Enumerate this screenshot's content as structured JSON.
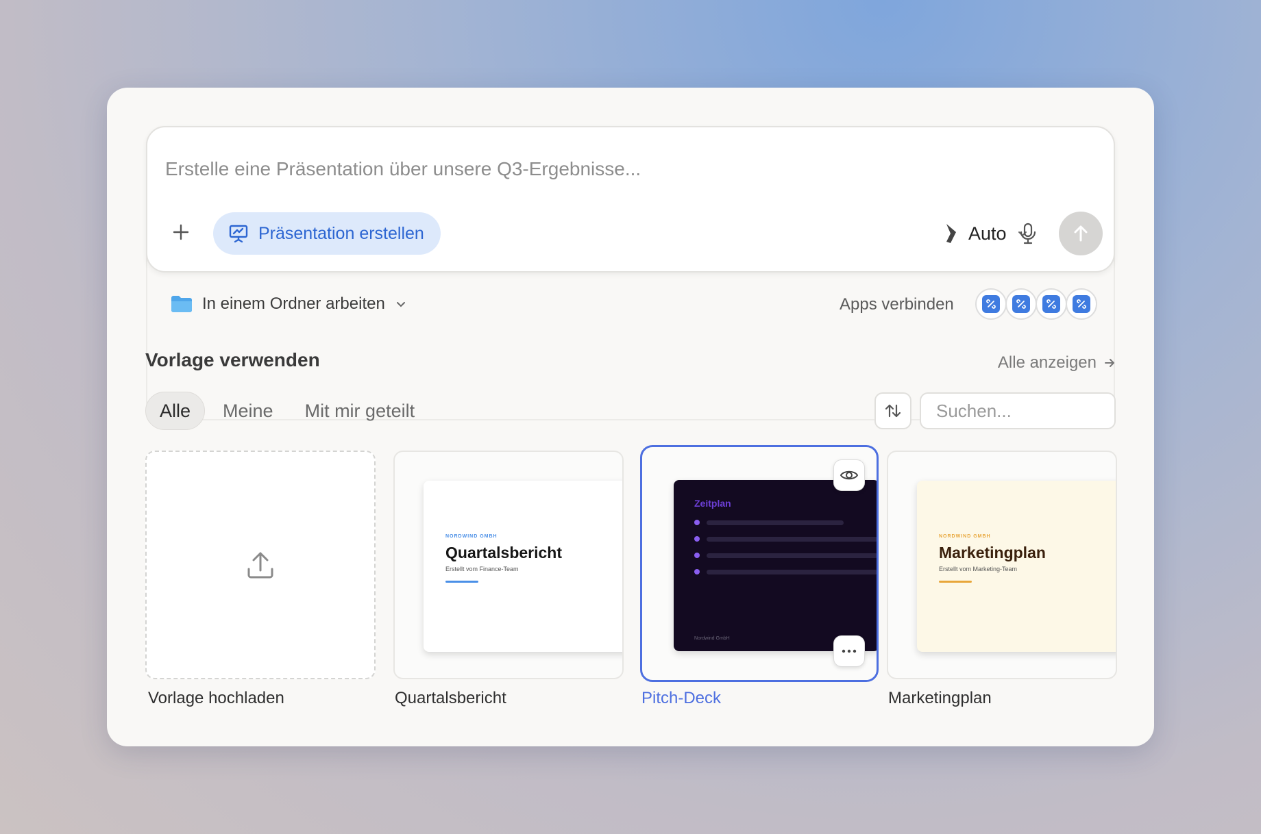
{
  "composer": {
    "placeholder": "Erstelle eine Präsentation über unsere Q3-Ergebnisse...",
    "mode_label": "Präsentation erstellen",
    "model_label": "Auto"
  },
  "workspace": {
    "folder_label": "In einem Ordner arbeiten",
    "apps_label": "Apps verbinden"
  },
  "templates": {
    "section_title": "Vorlage verwenden",
    "see_all": "Alle anzeigen",
    "tabs": [
      {
        "label": "Alle",
        "active": true
      },
      {
        "label": "Meine",
        "active": false
      },
      {
        "label": "Mit mir geteilt",
        "active": false
      }
    ],
    "search_placeholder": "Suchen...",
    "upload_label": "Vorlage hochladen",
    "items": [
      {
        "label": "Quartalsbericht",
        "kicker": "NORDWIND GMBH",
        "title": "Quartalsbericht",
        "subtitle": "Erstellt vom Finance-Team",
        "accent": "#4a8fe7"
      },
      {
        "label": "Pitch-Deck",
        "title": "Zeitplan",
        "footer": "Nordwind GmbH",
        "accent": "#6c3fd6",
        "selected": true
      },
      {
        "label": "Marketingplan",
        "kicker": "NORDWIND GMBH",
        "title": "Marketingplan",
        "subtitle": "Erstellt vom Marketing-Team",
        "accent": "#e8a63a"
      }
    ]
  },
  "colors": {
    "accent_blue": "#2d66d2",
    "selection": "#4d6fe0"
  }
}
